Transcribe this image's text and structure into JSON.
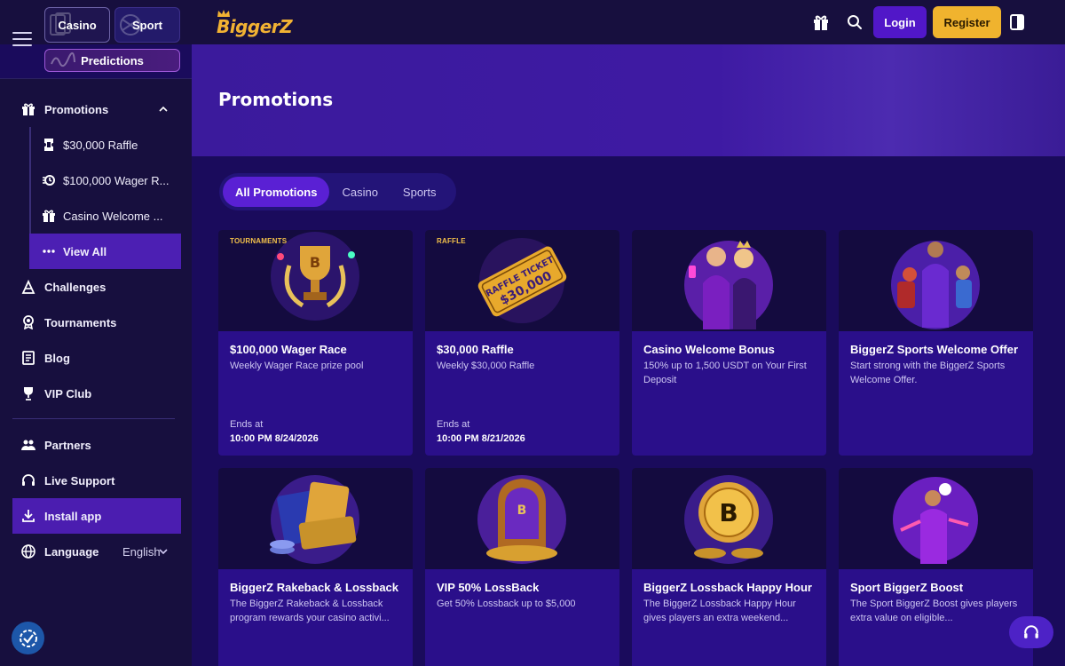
{
  "header": {
    "casino_label": "Casino",
    "sport_label": "Sport",
    "predictions_label": "Predictions",
    "logo_text": "BiggerZ",
    "login_label": "Login",
    "register_label": "Register"
  },
  "sidebar": {
    "promotions_label": "Promotions",
    "sub_items": [
      {
        "label": "$30,000 Raffle",
        "icon": "raffle-icon"
      },
      {
        "label": "$100,000 Wager R...",
        "icon": "race-icon"
      },
      {
        "label": "Casino Welcome ...",
        "icon": "gift-icon"
      },
      {
        "label": "View All",
        "icon": "dots-icon"
      }
    ],
    "items": [
      {
        "label": "Challenges",
        "icon": "challenges-icon"
      },
      {
        "label": "Tournaments",
        "icon": "tournaments-icon"
      },
      {
        "label": "Blog",
        "icon": "blog-icon"
      },
      {
        "label": "VIP Club",
        "icon": "vip-icon"
      }
    ],
    "bottom_items": [
      {
        "label": "Partners",
        "icon": "partners-icon"
      },
      {
        "label": "Live Support",
        "icon": "headset-icon"
      },
      {
        "label": "Install app",
        "icon": "download-icon"
      }
    ],
    "language_label": "Language",
    "language_value": "English"
  },
  "main": {
    "title": "Promotions",
    "tabs": [
      {
        "label": "All Promotions",
        "active": true
      },
      {
        "label": "Casino",
        "active": false
      },
      {
        "label": "Sports",
        "active": false
      }
    ],
    "cards": [
      {
        "badge": "TOURNAMENTS",
        "title": "$100,000 Wager Race",
        "desc": "Weekly Wager Race prize pool",
        "ends_label": "Ends at",
        "ends_date": "10:00 PM 8/24/2026",
        "art": "trophy"
      },
      {
        "badge": "RAFFLE",
        "title": "$30,000 Raffle",
        "desc": "Weekly $30,000 Raffle",
        "ends_label": "Ends at",
        "ends_date": "10:00 PM 8/21/2026",
        "art": "ticket",
        "art_text": "RAFFLE TICKET",
        "art_amount": "$30,000"
      },
      {
        "badge": "",
        "title": "Casino Welcome Bonus",
        "desc": "150% up to 1,500 USDT on Your First Deposit",
        "ends_label": "",
        "ends_date": "",
        "art": "casino-hosts"
      },
      {
        "badge": "",
        "title": "BiggerZ Sports Welcome Offer",
        "desc": "Start strong with the BiggerZ Sports Welcome Offer.",
        "ends_label": "",
        "ends_date": "",
        "art": "athletes"
      },
      {
        "badge": "",
        "title": "BiggerZ Rakeback & Lossback",
        "desc": "The BiggerZ Rakeback & Lossback program rewards your casino activi...",
        "ends_label": "",
        "ends_date": "",
        "art": "loyalty-cards"
      },
      {
        "badge": "",
        "title": "VIP 50% LossBack",
        "desc": "Get 50% Lossback up to $5,000",
        "ends_label": "",
        "ends_date": "",
        "art": "throne"
      },
      {
        "badge": "",
        "title": "BiggerZ Lossback Happy Hour",
        "desc": "The BiggerZ Lossback Happy Hour gives players an extra weekend...",
        "ends_label": "",
        "ends_date": "",
        "art": "gold-coin"
      },
      {
        "badge": "",
        "title": "Sport BiggerZ Boost",
        "desc": "The Sport BiggerZ Boost gives players extra value on eligible...",
        "ends_label": "",
        "ends_date": "",
        "art": "footballer"
      }
    ]
  },
  "colors": {
    "background": "#1a0b5c",
    "sidebar": "#170f3e",
    "accent_purple": "#5117c8",
    "accent_gold": "#f0b32e",
    "card": "#2a0f8a"
  }
}
